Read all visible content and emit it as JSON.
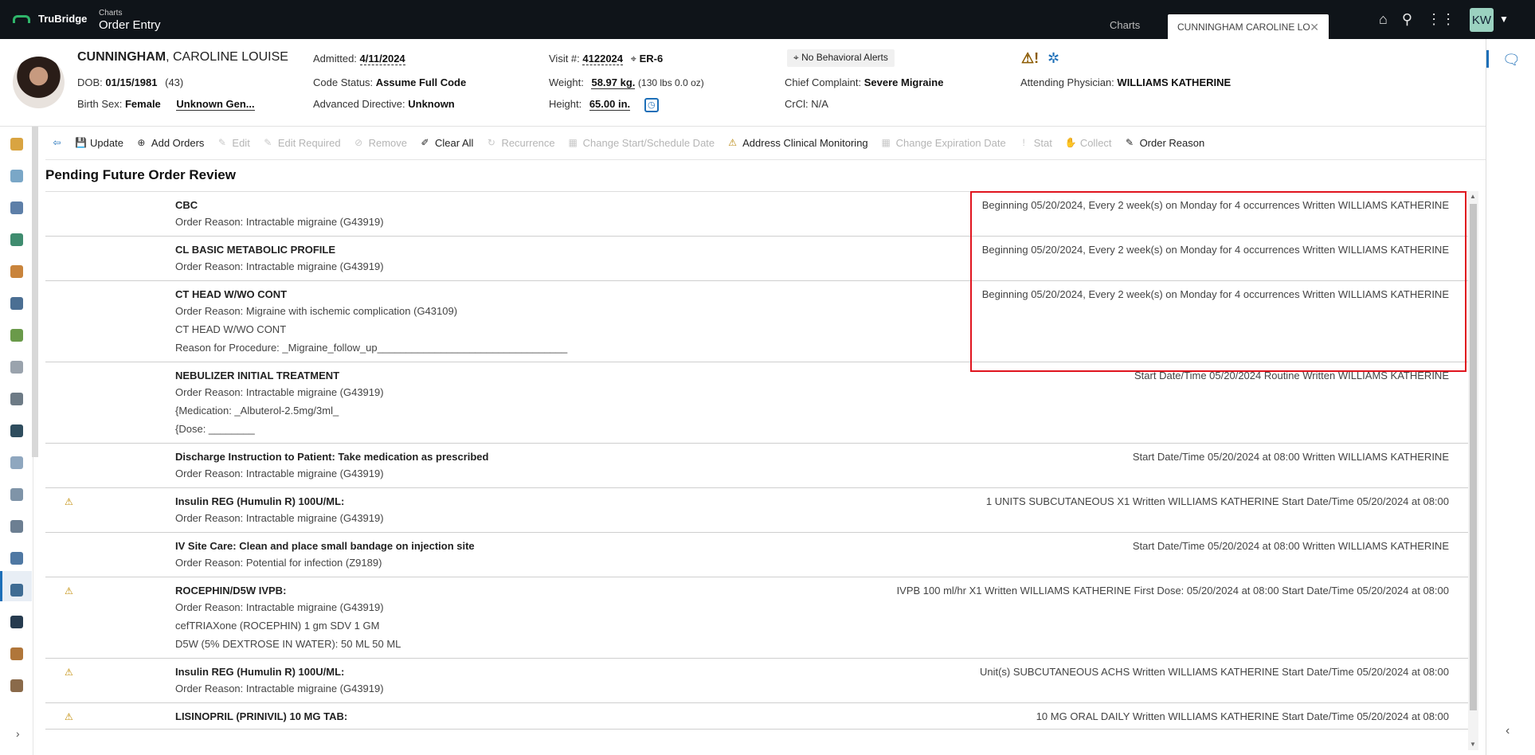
{
  "app": {
    "brand": "TruBridge",
    "module_small": "Charts",
    "module_big": "Order Entry",
    "tab_charts": "Charts",
    "tab_patient": "CUNNINGHAM CAROLINE LO",
    "user_initials": "KW",
    "icons": [
      "home-icon",
      "search-icon",
      "apps-grid-icon"
    ]
  },
  "patient": {
    "last_name": "CUNNINGHAM",
    "first_names": ", CAROLINE LOUISE",
    "dob_label": "DOB:",
    "dob": "01/15/1981",
    "age": "(43)",
    "birth_sex_label": "Birth Sex:",
    "birth_sex": "Female",
    "gender": "Unknown Gen...",
    "admitted_label": "Admitted:",
    "admitted": "4/11/2024",
    "code_status_label": "Code Status:",
    "code_status": "Assume Full Code",
    "adv_directive_label": "Advanced Directive:",
    "adv_directive": "Unknown",
    "visit_label": "Visit #:",
    "visit": "4122024",
    "location": "ER-6",
    "weight_label": "Weight:",
    "weight": "58.97 kg.",
    "weight_lbs": "(130 lbs 0.0 oz)",
    "height_label": "Height:",
    "height": "65.00 in.",
    "behavioral_alert": "No Behavioral Alerts",
    "chief_complaint_label": "Chief Complaint:",
    "chief_complaint": "Severe Migraine",
    "crcl_label": "CrCl:",
    "crcl": "N/A",
    "attending_label": "Attending Physician:",
    "attending": "WILLIAMS KATHERINE"
  },
  "toolbar": [
    {
      "label": "Update",
      "icon": "save-icon",
      "disabled": false
    },
    {
      "label": "Add Orders",
      "icon": "add-circle-icon",
      "disabled": false
    },
    {
      "label": "Edit",
      "icon": "edit-icon",
      "disabled": true
    },
    {
      "label": "Edit Required",
      "icon": "edit-required-icon",
      "disabled": true
    },
    {
      "label": "Remove",
      "icon": "remove-icon",
      "disabled": true
    },
    {
      "label": "Clear All",
      "icon": "eraser-icon",
      "disabled": false
    },
    {
      "label": "Recurrence",
      "icon": "recurrence-icon",
      "disabled": true
    },
    {
      "label": "Change Start/Schedule Date",
      "icon": "calendar-icon",
      "disabled": true
    },
    {
      "label": "Address Clinical Monitoring",
      "icon": "warning-icon",
      "disabled": false
    },
    {
      "label": "Change Expiration Date",
      "icon": "calendar-expire-icon",
      "disabled": true
    },
    {
      "label": "Stat",
      "icon": "exclamation-icon",
      "disabled": true
    },
    {
      "label": "Collect",
      "icon": "collect-icon",
      "disabled": true
    },
    {
      "label": "Order Reason",
      "icon": "order-reason-icon",
      "disabled": false
    }
  ],
  "section_title": "Pending Future Order Review",
  "orders": [
    {
      "name": "CBC",
      "warn": false,
      "lines": [
        "Order Reason: Intractable migraine (G43919)"
      ],
      "right": "Beginning 05/20/2024, Every 2 week(s) on Monday for 4 occurrences Written WILLIAMS KATHERINE"
    },
    {
      "name": "CL BASIC METABOLIC PROFILE",
      "warn": false,
      "lines": [
        "Order Reason: Intractable migraine (G43919)"
      ],
      "right": "Beginning 05/20/2024, Every 2 week(s) on Monday for 4 occurrences Written WILLIAMS KATHERINE"
    },
    {
      "name": "CT HEAD W/WO CONT",
      "warn": false,
      "lines": [
        "Order Reason: Migraine with ischemic complication (G43109)",
        "CT HEAD W/WO CONT",
        "Reason for Procedure: _Migraine_follow_up_________________________________"
      ],
      "right": "Beginning 05/20/2024, Every 2 week(s) on Monday for 4 occurrences Written WILLIAMS KATHERINE"
    },
    {
      "name": "NEBULIZER INITIAL TREATMENT",
      "warn": false,
      "lines": [
        "Order Reason: Intractable migraine (G43919)",
        "{Medication: _Albuterol-2.5mg/3ml_",
        "{Dose: ________"
      ],
      "right": "Start Date/Time 05/20/2024 Routine Written WILLIAMS KATHERINE"
    },
    {
      "name": "Discharge Instruction to Patient: Take medication as prescribed",
      "warn": false,
      "lines": [
        "Order Reason: Intractable migraine (G43919)"
      ],
      "right": "Start Date/Time 05/20/2024 at 08:00 Written WILLIAMS KATHERINE"
    },
    {
      "name": "Insulin REG (Humulin R) 100U/ML:",
      "warn": true,
      "lines": [
        "Order Reason: Intractable migraine (G43919)"
      ],
      "right": "1 UNITS SUBCUTANEOUS X1 Written WILLIAMS KATHERINE Start Date/Time 05/20/2024 at 08:00"
    },
    {
      "name": "IV Site Care: Clean and place small bandage on injection site",
      "warn": false,
      "lines": [
        "Order Reason: Potential for infection (Z9189)"
      ],
      "right": "Start Date/Time 05/20/2024 at 08:00 Written WILLIAMS KATHERINE"
    },
    {
      "name": "ROCEPHIN/D5W IVPB:",
      "warn": true,
      "lines": [
        "Order Reason: Intractable migraine (G43919)",
        "cefTRIAXone (ROCEPHIN) 1 gm SDV 1 GM",
        "D5W (5% DEXTROSE IN WATER): 50 ML 50 ML"
      ],
      "right": "IVPB 100 ml/hr X1 Written WILLIAMS KATHERINE First Dose: 05/20/2024 at 08:00 Start Date/Time 05/20/2024 at 08:00"
    },
    {
      "name": "Insulin REG (Humulin R) 100U/ML:",
      "warn": true,
      "lines": [
        "Order Reason: Intractable migraine (G43919)"
      ],
      "right": "Unit(s) SUBCUTANEOUS ACHS Written WILLIAMS KATHERINE Start Date/Time 05/20/2024 at 08:00"
    },
    {
      "name": "LISINOPRIL (PRINIVIL) 10 MG TAB:",
      "warn": true,
      "lines": [],
      "right": "10 MG ORAL DAILY Written WILLIAMS KATHERINE Start Date/Time 05/20/2024 at 08:00"
    }
  ],
  "colors": {
    "topbar": "#0f1419",
    "accent": "#1d6fb8",
    "highlight": "#e0141e",
    "warning": "#c08a00"
  }
}
